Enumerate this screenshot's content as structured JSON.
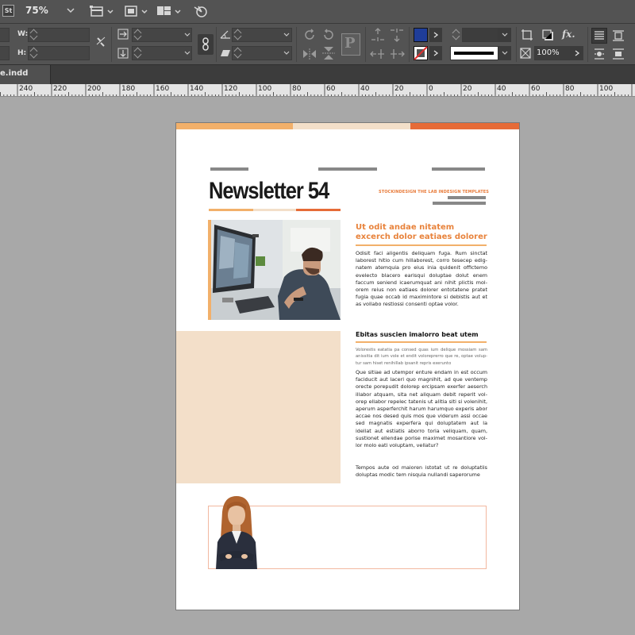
{
  "app": {
    "logo": "St",
    "zoom": "75%"
  },
  "control": {
    "w_label": "W:",
    "h_label": "H:",
    "scale": "100%"
  },
  "document": {
    "tab_title": "e.indd"
  },
  "ruler": {
    "labels": [
      "240",
      "220",
      "200",
      "180",
      "160",
      "140",
      "120",
      "100",
      "80",
      "60",
      "40",
      "20",
      "0",
      "20",
      "40",
      "60",
      "80",
      "100"
    ]
  },
  "newsletter": {
    "title": "Newsletter 54",
    "tagline": "STOCKINDESIGN THE LAB INDESIGN TEMPLATES",
    "headline": [
      "Ut odit andae nitatem",
      "excerch dolor eatiaes dolorer"
    ],
    "body1": "Odisit faci aligentis deliquam fuga. Rum sinctat laborest hitio cum hillaborest, corro tesecep edig-natem atemquia pro eius inia quidenit offictemo evelecto blacero earisqui doluptae dolut enem faccum seniend icaerumquat ani nihit plictis mol-orem reius non eatiaes dolorer entotatene pratet fugia quae occab id maximintore si debistis aut et as vollabo restiossi consenti optae volor.",
    "subhead": "Ebitas suscien imalorro beat utem",
    "lead": "Volorestis eatatia pa consed quas ium delique mossiam sam anissitia dit ium vole et endit voloreprerro que re, optae volup-tur sam hiset renihillab ipsanit repris exerunto",
    "body2": "Que sitiae ad utempor enture endam in est occum faciducit aut laceri quo magnihit, ad que ventemp orecte porepudit dolorep ercipsam exerfer aeserch illabor atquam, sita net aliquam debit reperit vol-orep ellabor repelec tatenis ut alitia siti si volenihit, aperum asperferchit harum harumquo experis abor accae nos desed quis mos que viderum assi occae sed magnatis experfera qui doluptatem aut la idellat aut estiatis aborro toria veliquam, quam, sustionet ellendae porise maximet mosantiore vol-lor molo eati voluptam, vellatur?",
    "body3": "Tempos aute od maioren istotat ut re doluptatiis doluptas modic tem nisquia nullandi saperorume"
  },
  "colors": {
    "orange": "#e8833c",
    "light_orange": "#f2b06a",
    "peach": "#f3dfc9",
    "deep_orange": "#e66b37",
    "fill_swatch": "#1f3d99"
  }
}
